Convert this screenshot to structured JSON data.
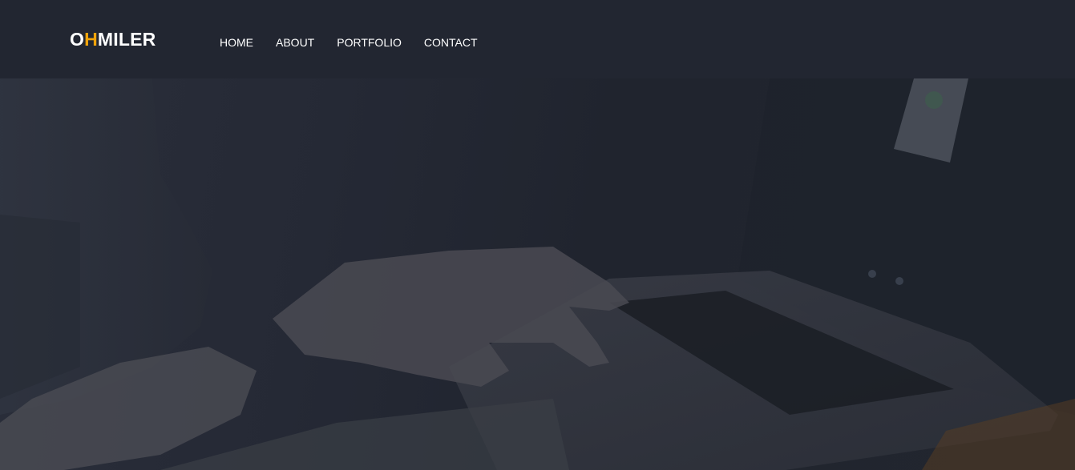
{
  "brand": {
    "logo_part1": "O",
    "logo_accent": "H",
    "logo_part2": "MILER",
    "accent_color": "#f0a30a"
  },
  "nav": {
    "items": [
      {
        "label": "HOME"
      },
      {
        "label": "ABOUT"
      },
      {
        "label": "PORTFOLIO"
      },
      {
        "label": "CONTACT"
      }
    ]
  },
  "hero": {
    "background_description": "person-typing-on-laptop-photo"
  },
  "colors": {
    "navbar_bg": "#222631",
    "hero_overlay": "#232733",
    "text": "#ffffff"
  }
}
